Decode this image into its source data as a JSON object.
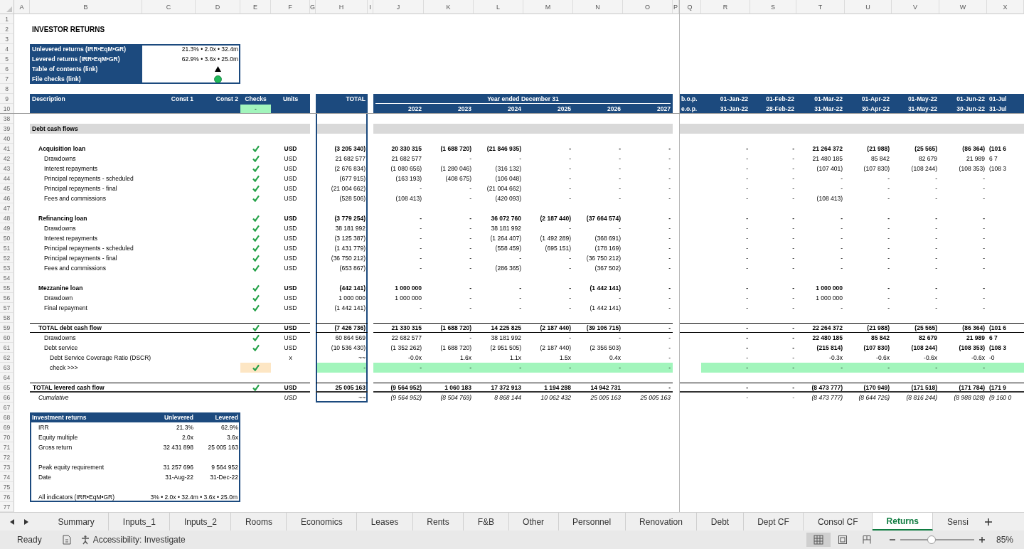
{
  "columns": [
    "A",
    "B",
    "C",
    "D",
    "E",
    "F",
    "G",
    "H",
    "I",
    "J",
    "K",
    "L",
    "M",
    "N",
    "O",
    "P",
    "Q",
    "R",
    "S",
    "T",
    "U",
    "V",
    "W",
    "X"
  ],
  "row_numbers": [
    "1",
    "2",
    "3",
    "4",
    "5",
    "6",
    "7",
    "8",
    "9",
    "10",
    "38",
    "39",
    "40",
    "41",
    "42",
    "43",
    "44",
    "45",
    "46",
    "47",
    "48",
    "49",
    "50",
    "51",
    "52",
    "53",
    "54",
    "55",
    "56",
    "57",
    "58",
    "59",
    "60",
    "61",
    "62",
    "63",
    "64",
    "65",
    "66",
    "67",
    "68",
    "69",
    "70",
    "71",
    "72",
    "73",
    "74",
    "75",
    "76",
    "77"
  ],
  "title": "INVESTOR RETURNS",
  "summary": [
    {
      "kind": "value",
      "label": "Unlevered returns (IRR•EqM•GR)",
      "value": "21.3% • 2.0x • 32.4m"
    },
    {
      "kind": "value",
      "label": "Levered returns (IRR•EqM•GR)",
      "value": "62.9% • 3.6x • 25.0m"
    },
    {
      "kind": "link",
      "label": "Table of contents (link)"
    },
    {
      "kind": "status",
      "label": "File checks (link)"
    }
  ],
  "header": {
    "description": "Description",
    "const_1": "Const 1",
    "const_2": "Const 2",
    "checks": "Checks",
    "check_status": "-",
    "units": "Units",
    "total": "TOTAL",
    "period": "Year ended December 31",
    "years": [
      "2022",
      "2023",
      "2024",
      "2025",
      "2026",
      "2027"
    ],
    "bop": "b.o.p.",
    "eop": "e.o.p.",
    "period_starts": [
      "01-Jan-22",
      "01-Feb-22",
      "01-Mar-22",
      "01-Apr-22",
      "01-May-22",
      "01-Jun-22",
      "01-Jul"
    ],
    "period_ends": [
      "31-Jan-22",
      "28-Feb-22",
      "31-Mar-22",
      "30-Apr-22",
      "31-May-22",
      "30-Jun-22",
      "31-Jul"
    ]
  },
  "rows": [
    {
      "kind": "gap"
    },
    {
      "kind": "section",
      "label": "Debt cash flows"
    },
    {
      "kind": "gap"
    },
    {
      "kind": "group",
      "label": "Acquisition loan",
      "checked": true,
      "units": "USD",
      "total": "(3 205 340)",
      "years": [
        "20 330 315",
        "(1 688 720)",
        "(21 846 935)",
        "-",
        "-",
        "-"
      ],
      "months": [
        "-",
        "-",
        "21 264 372",
        "(21 988)",
        "(25 565)",
        "(86 364)",
        "(101 6"
      ]
    },
    {
      "kind": "line",
      "label": "Drawdowns",
      "checked": true,
      "units": "USD",
      "total": "21 682 577",
      "years": [
        "21 682 577",
        "-",
        "-",
        "-",
        "-",
        "-"
      ],
      "months": [
        "-",
        "-",
        "21 480 185",
        "85 842",
        "82 679",
        "21 989",
        "6 7"
      ]
    },
    {
      "kind": "line",
      "label": "Interest repayments",
      "checked": true,
      "units": "USD",
      "total": "(2 676 834)",
      "years": [
        "(1 080 656)",
        "(1 280 046)",
        "(316 132)",
        "-",
        "-",
        "-"
      ],
      "months": [
        "-",
        "-",
        "(107 401)",
        "(107 830)",
        "(108 244)",
        "(108 353)",
        "(108 3"
      ]
    },
    {
      "kind": "line",
      "label": "Principal repayments - scheduled",
      "checked": true,
      "units": "USD",
      "total": "(677 915)",
      "years": [
        "(163 193)",
        "(408 675)",
        "(106 048)",
        "-",
        "-",
        "-"
      ],
      "months": [
        "-",
        "-",
        "-",
        "-",
        "-",
        "-"
      ]
    },
    {
      "kind": "line",
      "label": "Principal repayments - final",
      "checked": true,
      "units": "USD",
      "total": "(21 004 662)",
      "years": [
        "-",
        "-",
        "(21 004 662)",
        "-",
        "-",
        "-"
      ],
      "months": [
        "-",
        "-",
        "-",
        "-",
        "-",
        "-"
      ]
    },
    {
      "kind": "line",
      "label": "Fees and commissions",
      "checked": true,
      "units": "USD",
      "total": "(528 506)",
      "years": [
        "(108 413)",
        "-",
        "(420 093)",
        "-",
        "-",
        "-"
      ],
      "months": [
        "-",
        "-",
        "(108 413)",
        "-",
        "-",
        "-"
      ]
    },
    {
      "kind": "gap"
    },
    {
      "kind": "group",
      "label": "Refinancing loan",
      "checked": true,
      "units": "USD",
      "total": "(3 779 254)",
      "years": [
        "-",
        "-",
        "36 072 760",
        "(2 187 440)",
        "(37 664 574)",
        "-"
      ],
      "months": [
        "-",
        "-",
        "-",
        "-",
        "-",
        "-"
      ]
    },
    {
      "kind": "line",
      "label": "Drawdowns",
      "checked": true,
      "units": "USD",
      "total": "38 181 992",
      "years": [
        "-",
        "-",
        "38 181 992",
        "-",
        "-",
        "-"
      ],
      "months": [
        "-",
        "-",
        "-",
        "-",
        "-",
        "-"
      ]
    },
    {
      "kind": "line",
      "label": "Interest repayments",
      "checked": true,
      "units": "USD",
      "total": "(3 125 387)",
      "years": [
        "-",
        "-",
        "(1 264 407)",
        "(1 492 289)",
        "(368 691)",
        "-"
      ],
      "months": [
        "-",
        "-",
        "-",
        "-",
        "-",
        "-"
      ]
    },
    {
      "kind": "line",
      "label": "Principal repayments - scheduled",
      "checked": true,
      "units": "USD",
      "total": "(1 431 779)",
      "years": [
        "-",
        "-",
        "(558 459)",
        "(695 151)",
        "(178 169)",
        "-"
      ],
      "months": [
        "-",
        "-",
        "-",
        "-",
        "-",
        "-"
      ]
    },
    {
      "kind": "line",
      "label": "Principal repayments - final",
      "checked": true,
      "units": "USD",
      "total": "(36 750 212)",
      "years": [
        "-",
        "-",
        "-",
        "-",
        "(36 750 212)",
        "-"
      ],
      "months": [
        "-",
        "-",
        "-",
        "-",
        "-",
        "-"
      ]
    },
    {
      "kind": "line",
      "label": "Fees and commissions",
      "checked": true,
      "units": "USD",
      "total": "(653 867)",
      "years": [
        "-",
        "-",
        "(286 365)",
        "-",
        "(367 502)",
        "-"
      ],
      "months": [
        "-",
        "-",
        "-",
        "-",
        "-",
        "-"
      ]
    },
    {
      "kind": "gap"
    },
    {
      "kind": "group",
      "label": "Mezzanine loan",
      "checked": true,
      "units": "USD",
      "total": "(442 141)",
      "years": [
        "1 000 000",
        "-",
        "-",
        "-",
        "(1 442 141)",
        "-"
      ],
      "months": [
        "-",
        "-",
        "1 000 000",
        "-",
        "-",
        "-"
      ]
    },
    {
      "kind": "line",
      "label": "Drawdown",
      "checked": true,
      "units": "USD",
      "total": "1 000 000",
      "years": [
        "1 000 000",
        "-",
        "-",
        "-",
        "-",
        "-"
      ],
      "months": [
        "-",
        "-",
        "1 000 000",
        "-",
        "-",
        "-"
      ]
    },
    {
      "kind": "line",
      "label": "Final repayment",
      "checked": true,
      "units": "USD",
      "total": "(1 442 141)",
      "years": [
        "-",
        "-",
        "-",
        "-",
        "(1 442 141)",
        "-"
      ],
      "months": [
        "-",
        "-",
        "-",
        "-",
        "-",
        "-"
      ]
    },
    {
      "kind": "gap"
    },
    {
      "kind": "subtotal",
      "label": "TOTAL debt cash flow",
      "checked": true,
      "units": "USD",
      "total": "(7 426 736)",
      "years": [
        "21 330 315",
        "(1 688 720)",
        "14 225 825",
        "(2 187 440)",
        "(39 106 715)",
        "-"
      ],
      "months": [
        "-",
        "-",
        "22 264 372",
        "(21 988)",
        "(25 565)",
        "(86 364)",
        "(101 6"
      ]
    },
    {
      "kind": "breakdown",
      "label": "Drawdowns",
      "checked": true,
      "units": "USD",
      "total": "60 864 569",
      "years": [
        "22 682 577",
        "-",
        "38 181 992",
        "-",
        "-",
        "-"
      ],
      "months": [
        "-",
        "-",
        "22 480 185",
        "85 842",
        "82 679",
        "21 989",
        "6 7"
      ]
    },
    {
      "kind": "breakdown",
      "label": "Debt service",
      "checked": true,
      "units": "USD",
      "total": "(10 536 430)",
      "years": [
        "(1 352 262)",
        "(1 688 720)",
        "(2 951 505)",
        "(2 187 440)",
        "(2 356 503)",
        "-"
      ],
      "months": [
        "-",
        "-",
        "(215 814)",
        "(107 830)",
        "(108 244)",
        "(108 353)",
        "(108 3"
      ]
    },
    {
      "kind": "ratio",
      "label": "Debt Service Coverage Ratio (DSCR)",
      "checked": false,
      "units": "x",
      "total": "~~",
      "years": [
        "-0.0x",
        "1.6x",
        "1.1x",
        "1.5x",
        "0.4x",
        "-"
      ],
      "months": [
        "-",
        "-",
        "-0.3x",
        "-0.6x",
        "-0.6x",
        "-0.6x",
        "-0"
      ]
    },
    {
      "kind": "check",
      "label": "check >>>",
      "checked": true,
      "total": "-",
      "years": [
        "-",
        "-",
        "-",
        "-",
        "-",
        "-"
      ],
      "months": [
        "-",
        "-",
        "-",
        "-",
        "-",
        "-"
      ]
    },
    {
      "kind": "gap"
    },
    {
      "kind": "grand",
      "label": "TOTAL levered cash flow",
      "checked": true,
      "units": "USD",
      "total": "25 005 163",
      "years": [
        "(9 564 952)",
        "1 060 183",
        "17 372 913",
        "1 194 288",
        "14 942 731",
        "-"
      ],
      "months": [
        "-",
        "-",
        "(8 473 777)",
        "(170 949)",
        "(171 518)",
        "(171 784)",
        "(171 9"
      ]
    },
    {
      "kind": "cumulative",
      "label": "Cumulative",
      "checked": false,
      "units": "USD",
      "total": "~~",
      "years": [
        "(9 564 952)",
        "(8 504 769)",
        "8 868 144",
        "10 062 432",
        "25 005 163",
        "25 005 163"
      ],
      "months": [
        "-",
        "-",
        "(8 473 777)",
        "(8 644 726)",
        "(8 816 244)",
        "(8 988 028)",
        "(9 160 0"
      ]
    }
  ],
  "returns": {
    "title": "Investment returns",
    "columns": [
      "Unlevered",
      "Levered"
    ],
    "rows": [
      {
        "kind": "line",
        "label": "IRR",
        "values": [
          "21.3%",
          "62.9%"
        ]
      },
      {
        "kind": "line",
        "label": "Equity multiple",
        "values": [
          "2.0x",
          "3.6x"
        ]
      },
      {
        "kind": "line",
        "label": "Gross return",
        "values": [
          "32 431 898",
          "25 005 163"
        ]
      },
      {
        "kind": "gap"
      },
      {
        "kind": "line",
        "label": "Peak equity requirement",
        "values": [
          "31 257 696",
          "9 564 952"
        ]
      },
      {
        "kind": "line",
        "label": "Date",
        "values": [
          "31-Aug-22",
          "31-Dec-22"
        ]
      },
      {
        "kind": "gap"
      },
      {
        "kind": "wide",
        "label": "All indicators (IRR•EqM•GR)",
        "value": "3% • 2.0x • 32.4m • 3.6x • 25.0m"
      }
    ]
  },
  "sheet_tabs": [
    {
      "label": "Summary",
      "selected": false
    },
    {
      "label": "Inputs_1",
      "selected": false
    },
    {
      "label": "Inputs_2",
      "selected": false
    },
    {
      "label": "Rooms",
      "selected": false
    },
    {
      "label": "Economics",
      "selected": false
    },
    {
      "label": "Leases",
      "selected": false
    },
    {
      "label": "Rents",
      "selected": false
    },
    {
      "label": "F&B",
      "selected": false
    },
    {
      "label": "Other",
      "selected": false
    },
    {
      "label": "Personnel",
      "selected": false
    },
    {
      "label": "Renovation",
      "selected": false
    },
    {
      "label": "Debt",
      "selected": false
    },
    {
      "label": "Dept CF",
      "selected": false
    },
    {
      "label": "Consol CF",
      "selected": false
    },
    {
      "label": "Returns",
      "selected": true
    },
    {
      "label": "Sensi",
      "selected": false
    }
  ],
  "status_bar": {
    "status": "Ready",
    "accessibility": "Accessibility: Investigate",
    "views": [
      {
        "kind": "normal",
        "selected": true
      },
      {
        "kind": "page_layout",
        "selected": false
      },
      {
        "kind": "page_break",
        "selected": false
      }
    ],
    "zoom": {
      "level": 0.42,
      "reading": "85%"
    }
  }
}
